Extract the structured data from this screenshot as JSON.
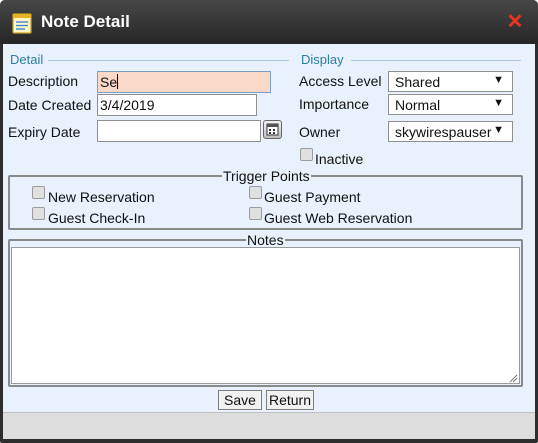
{
  "window": {
    "title": "Note Detail",
    "icon": "notepad-icon",
    "close_icon": "close-icon"
  },
  "detail": {
    "section_title": "Detail",
    "description": {
      "label": "Description",
      "value": "Se"
    },
    "date_created": {
      "label": "Date Created",
      "value": "3/4/2019"
    },
    "expiry_date": {
      "label": "Expiry Date",
      "value": "",
      "icon": "calendar-icon"
    }
  },
  "display": {
    "section_title": "Display",
    "access_level": {
      "label": "Access Level",
      "value": "Shared"
    },
    "importance": {
      "label": "Importance",
      "value": "Normal"
    },
    "owner": {
      "label": "Owner",
      "value": "skywirespauser"
    },
    "inactive": {
      "label": "Inactive",
      "checked": false
    },
    "dropdown_arrow": "▼"
  },
  "trigger_points": {
    "title": "Trigger Points",
    "items": [
      {
        "label": "New Reservation",
        "checked": false
      },
      {
        "label": "Guest Payment",
        "checked": false
      },
      {
        "label": "Guest Check-In",
        "checked": false
      },
      {
        "label": "Guest Web Reservation",
        "checked": false
      }
    ]
  },
  "notes": {
    "title": "Notes",
    "value": ""
  },
  "buttons": {
    "save": "Save",
    "return": "Return"
  },
  "colors": {
    "titlebar": "#2d2d2d",
    "accent": "#2a7fa5",
    "body_bg": "#e8f1fc",
    "close": "#ee3322",
    "focus_bg": "#fbd9c8"
  }
}
